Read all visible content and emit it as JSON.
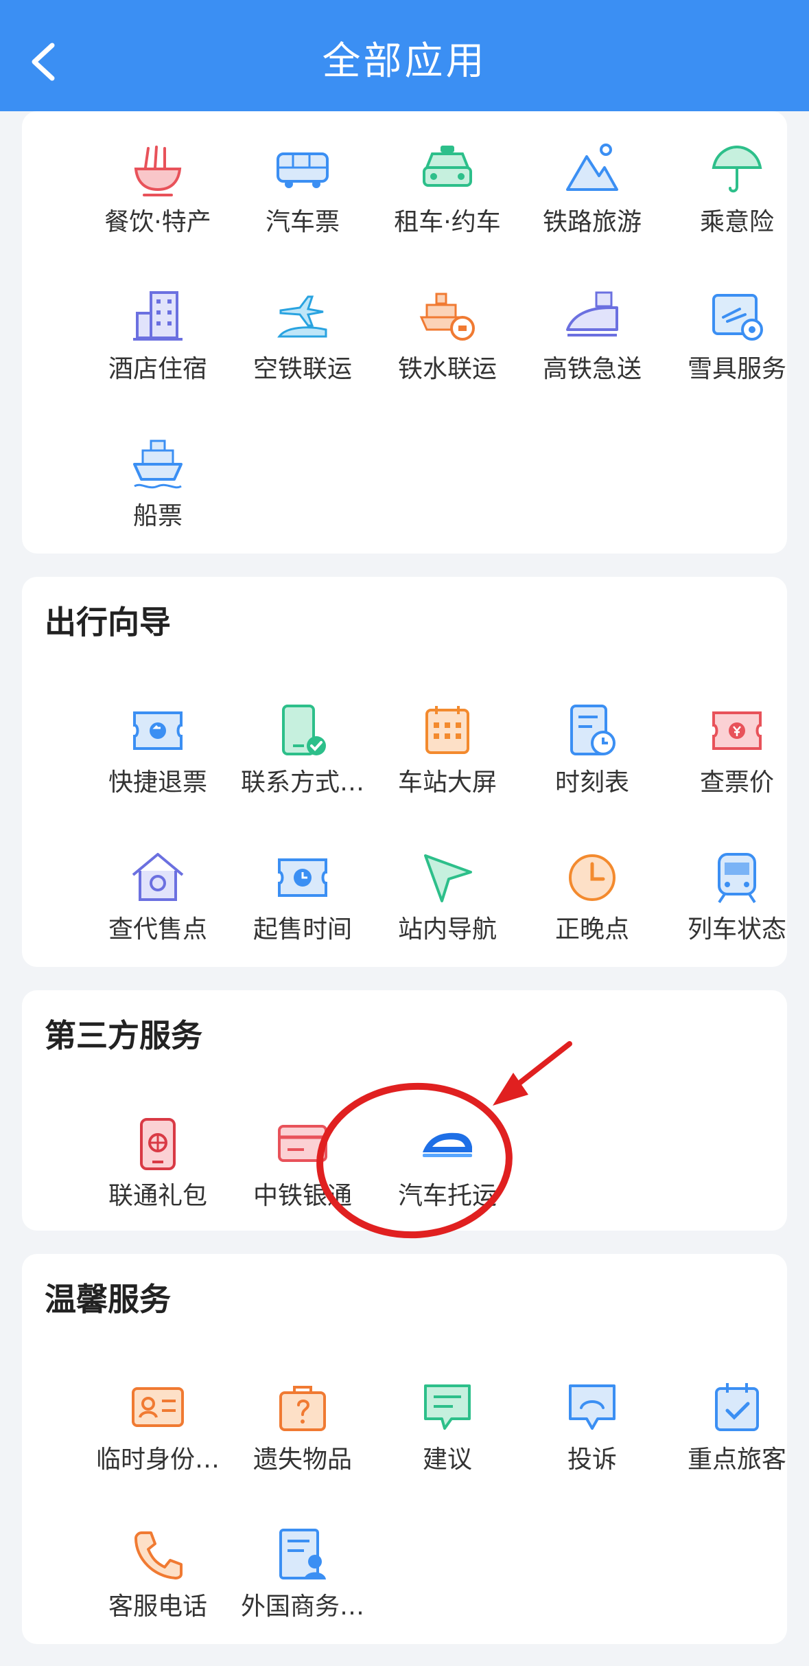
{
  "header": {
    "title": "全部应用",
    "back_icon": "chevron-left-icon"
  },
  "colors": {
    "header_bg": "#3b8ff3",
    "card_bg": "#ffffff",
    "page_bg": "#f2f4f7",
    "annotation": "#e02020"
  },
  "sections": {
    "top": {
      "items": [
        {
          "label": "餐饮·特产",
          "icon": "noodle-bowl-icon"
        },
        {
          "label": "汽车票",
          "icon": "bus-icon"
        },
        {
          "label": "租车·约车",
          "icon": "taxi-icon"
        },
        {
          "label": "铁路旅游",
          "icon": "mountain-icon"
        },
        {
          "label": "乘意险",
          "icon": "umbrella-icon"
        },
        {
          "label": "酒店住宿",
          "icon": "hotel-building-icon"
        },
        {
          "label": "空铁联运",
          "icon": "plane-train-icon"
        },
        {
          "label": "铁水联运",
          "icon": "ship-train-icon"
        },
        {
          "label": "高铁急送",
          "icon": "express-train-icon"
        },
        {
          "label": "雪具服务",
          "icon": "ski-service-icon"
        },
        {
          "label": "船票",
          "icon": "ship-icon"
        }
      ]
    },
    "guide": {
      "title": "出行向导",
      "items": [
        {
          "label": "快捷退票",
          "icon": "refund-ticket-icon"
        },
        {
          "label": "联系方式…",
          "icon": "phone-check-icon"
        },
        {
          "label": "车站大屏",
          "icon": "station-screen-icon"
        },
        {
          "label": "时刻表",
          "icon": "timetable-icon"
        },
        {
          "label": "查票价",
          "icon": "price-ticket-icon"
        },
        {
          "label": "查代售点",
          "icon": "agency-house-icon"
        },
        {
          "label": "起售时间",
          "icon": "sale-time-icon"
        },
        {
          "label": "站内导航",
          "icon": "navigation-arrow-icon"
        },
        {
          "label": "正晚点",
          "icon": "clock-icon"
        },
        {
          "label": "列车状态",
          "icon": "train-status-icon"
        }
      ]
    },
    "third": {
      "title": "第三方服务",
      "items": [
        {
          "label": "联通礼包",
          "icon": "unicom-phone-icon"
        },
        {
          "label": "中铁银通",
          "icon": "bank-card-icon"
        },
        {
          "label": "汽车托运",
          "icon": "car-shipping-icon"
        }
      ]
    },
    "care": {
      "title": "温馨服务",
      "items": [
        {
          "label": "临时身份…",
          "icon": "id-card-icon"
        },
        {
          "label": "遗失物品",
          "icon": "lost-bag-icon"
        },
        {
          "label": "建议",
          "icon": "suggestion-icon"
        },
        {
          "label": "投诉",
          "icon": "complaint-icon"
        },
        {
          "label": "重点旅客",
          "icon": "priority-passenger-icon"
        },
        {
          "label": "客服电话",
          "icon": "phone-icon"
        },
        {
          "label": "外国商务…",
          "icon": "foreign-business-icon"
        }
      ]
    }
  }
}
